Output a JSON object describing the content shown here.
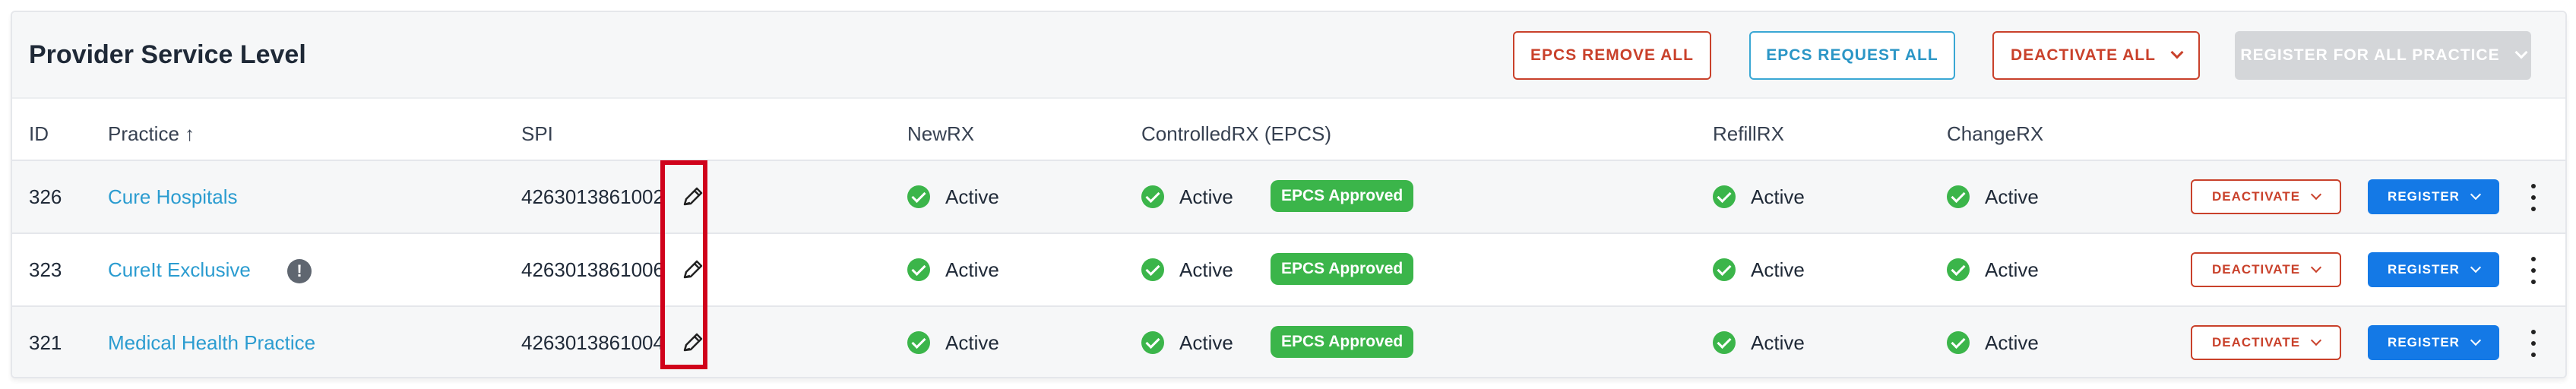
{
  "header": {
    "title": "Provider Service Level",
    "buttons": {
      "remove_all": "EPCS REMOVE ALL",
      "request_all": "EPCS REQUEST ALL",
      "deactivate_all": "DEACTIVATE ALL",
      "register_all": "REGISTER FOR ALL PRACTICE"
    }
  },
  "columns": {
    "id": "ID",
    "practice": "Practice ↑",
    "spi": "SPI",
    "newrx": "NewRX",
    "controlledrx": "ControlledRX (EPCS)",
    "refillrx": "RefillRX",
    "changerx": "ChangeRX"
  },
  "rows": [
    {
      "id": "326",
      "practice": "Cure Hospitals",
      "spi": "4263013861002",
      "newrx": "Active",
      "controlledrx": "Active",
      "epcs_badge": "EPCS Approved",
      "refillrx": "Active",
      "changerx": "Active",
      "deactivate": "DEACTIVATE",
      "register": "REGISTER"
    },
    {
      "id": "323",
      "practice": "CureIt Exclusive",
      "practice_info": "!",
      "spi": "4263013861006",
      "newrx": "Active",
      "controlledrx": "Active",
      "epcs_badge": "EPCS Approved",
      "refillrx": "Active",
      "changerx": "Active",
      "deactivate": "DEACTIVATE",
      "register": "REGISTER"
    },
    {
      "id": "321",
      "practice": "Medical Health Practice",
      "spi": "4263013861004",
      "newrx": "Active",
      "controlledrx": "Active",
      "epcs_badge": "EPCS Approved",
      "refillrx": "Active",
      "changerx": "Active",
      "deactivate": "DEACTIVATE",
      "register": "REGISTER"
    }
  ],
  "icons": {
    "edit": "pencil-icon",
    "status": "check-circle-icon",
    "menu": "kebab-menu-icon",
    "dropdown": "chevron-down-icon",
    "info": "exclamation-circle-icon"
  },
  "colors": {
    "active_green": "#3bb54a",
    "link_blue": "#2b9cd0",
    "danger_red": "#c9412b",
    "primary_blue": "#1479e6",
    "highlight_red": "#d0021b"
  }
}
